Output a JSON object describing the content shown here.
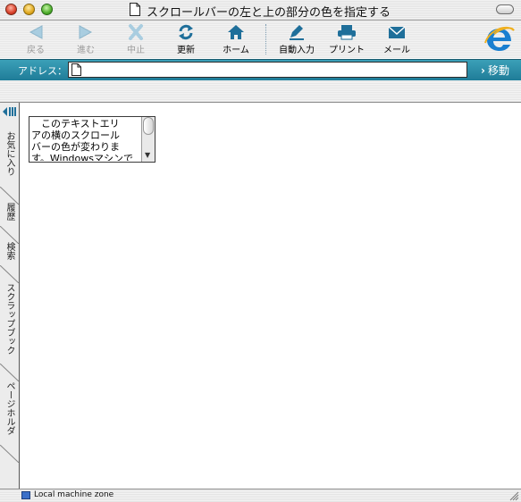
{
  "window": {
    "title": "スクロールバーの左と上の部分の色を指定する"
  },
  "toolbar": {
    "back_label": "戻る",
    "forward_label": "進む",
    "stop_label": "中止",
    "refresh_label": "更新",
    "home_label": "ホーム",
    "autofill_label": "自動入力",
    "print_label": "プリント",
    "mail_label": "メール"
  },
  "address": {
    "label": "アドレス：",
    "value": "",
    "go_label": "移動"
  },
  "sidebar": {
    "tabs": [
      "お気に入り",
      "履歴",
      "検索",
      "スクラップブック",
      "ページホルダ"
    ]
  },
  "content": {
    "textarea_text": "　このテキストエリ\nアの横のスクロール\nバーの色が変わりま\nす。Windowsマシンで"
  },
  "status": {
    "zone_text": "Local machine zone"
  },
  "colors": {
    "address_bar": "#2a8ca8",
    "toolbar_icon": "#1f6f9a",
    "disabled_icon": "#9fc3d8"
  }
}
